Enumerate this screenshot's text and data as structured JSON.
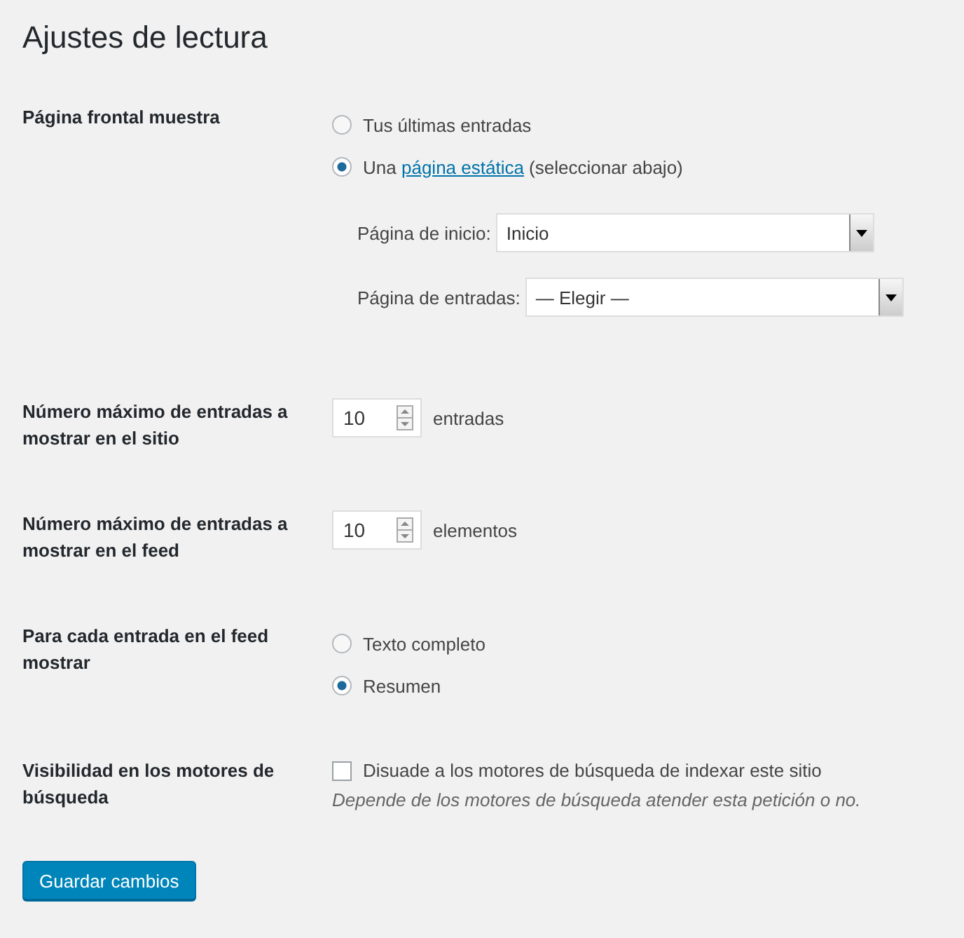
{
  "title": "Ajustes de lectura",
  "sections": [
    {
      "kind": "radios",
      "label": "Página frontal muestra",
      "options": [
        {
          "text": "Tus últimas entradas",
          "selected": false
        },
        {
          "text": "Una",
          "link": "página estática",
          "after": "(seleccionar abajo)",
          "selected": true
        }
      ],
      "selects": [
        {
          "label": "Página de inicio:",
          "value": "Inicio"
        },
        {
          "label": "Página de entradas:",
          "value": "— Elegir —"
        }
      ]
    },
    {
      "kind": "number",
      "label": "Número máximo de entradas a mostrar en el sitio",
      "value": "10",
      "unit": "entradas"
    },
    {
      "kind": "number",
      "label": "Número máximo de entradas a mostrar en el feed",
      "value": "10",
      "unit": "elementos"
    },
    {
      "kind": "radios",
      "label": "Para cada entrada en el feed mostrar",
      "options": [
        {
          "text": "Texto completo",
          "selected": false
        },
        {
          "text": "Resumen",
          "selected": true
        }
      ]
    },
    {
      "kind": "checkbox",
      "label": "Visibilidad en los motores de búsqueda",
      "text": "Disuade a los motores de búsqueda de indexar este sitio",
      "checked": false,
      "description": "Depende de los motores de búsqueda atender esta petición o no."
    }
  ],
  "button": "Guardar cambios"
}
